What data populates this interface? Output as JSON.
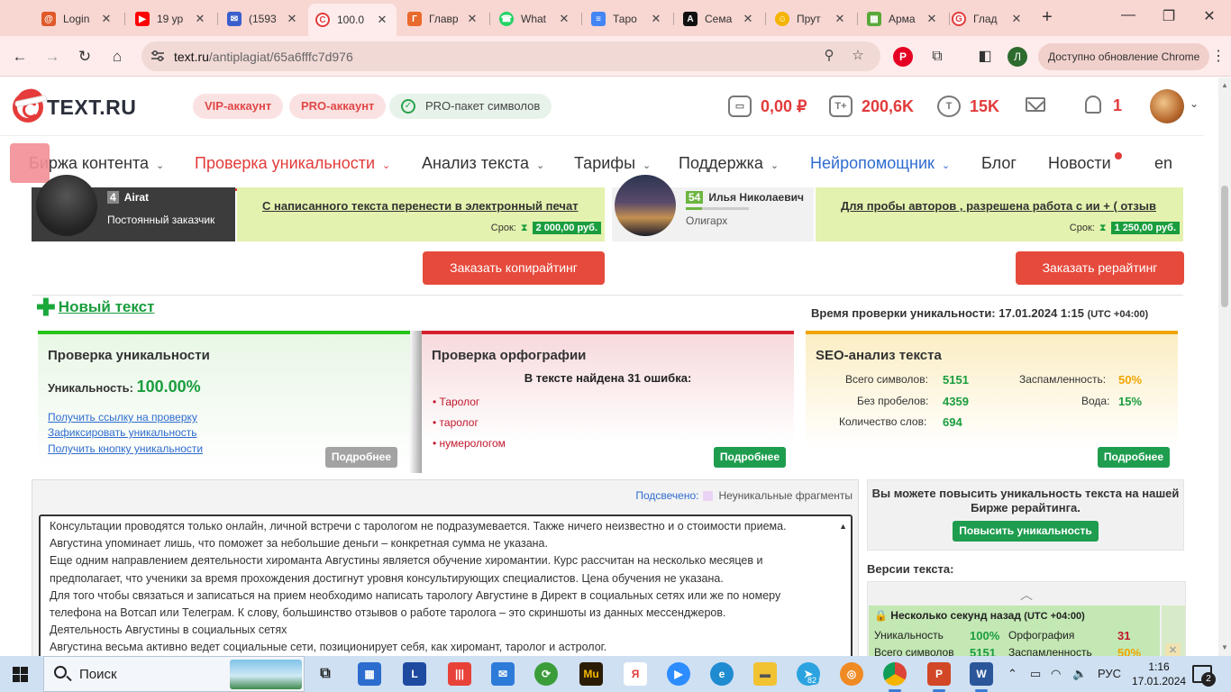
{
  "browser": {
    "tabs": [
      {
        "title": "Login",
        "icon": "mail-icon",
        "color": "#e05a2a"
      },
      {
        "title": "19 ур",
        "icon": "youtube-icon",
        "color": "#ff0000"
      },
      {
        "title": "(1593",
        "icon": "email-icon",
        "color": "#3a5fcd"
      },
      {
        "title": "100.0",
        "icon": "textru-icon",
        "color": "#e23b3b"
      },
      {
        "title": "Главр",
        "icon": "glavred-icon",
        "color": "#e86a2d"
      },
      {
        "title": "What",
        "icon": "whatsapp-icon",
        "color": "#25d366"
      },
      {
        "title": "Таро",
        "icon": "docs-icon",
        "color": "#4285f4"
      },
      {
        "title": "Сема",
        "icon": "advego-icon",
        "color": "#111111"
      },
      {
        "title": "Прут",
        "icon": "prutik-icon",
        "color": "#f4b400"
      },
      {
        "title": "Арма",
        "icon": "arma-icon",
        "color": "#5aa83a"
      },
      {
        "title": "Глад",
        "icon": "gladko-icon",
        "color": "#e23b3b"
      }
    ],
    "url_domain": "text.ru",
    "url_path": "/antiplagiat/65a6fffc7d976",
    "profile_initial": "Л",
    "update_label": "Доступно обновление Chrome"
  },
  "header": {
    "logo": "TEXT.RU",
    "vip": "VIP-аккаунт",
    "pro": "PRO-аккаунт",
    "pkg": "PRO-пакет символов",
    "balance": "0,00 ₽",
    "symbols": "200,6K",
    "tokens": "15K",
    "notifications": "1"
  },
  "nav": {
    "items": [
      "Биржа контента",
      "Проверка уникальности",
      "Анализ текста",
      "Тарифы",
      "Поддержка",
      "Нейропомощник",
      "Блог",
      "Новости",
      "en"
    ]
  },
  "orders": {
    "left_level": "4",
    "left_name": "Airat",
    "left_role": "Постоянный заказчик",
    "left_link": "С написанного текста перенести в электронный печат",
    "term": "Срок:",
    "left_price": "2 000,00 руб.",
    "mid_level": "54",
    "mid_name": "Илья Николаевич",
    "mid_role": "Олигарх",
    "right_link": "Для пробы авторов , разрешена работа с ии + ( отзыв",
    "right_price": "1 250,00 руб."
  },
  "buttons": {
    "order_copy": "Заказать копирайтинг",
    "order_rewrite": "Заказать рерайтинг"
  },
  "newtext": "Новый текст",
  "check_time": {
    "label": "Время проверки уникальности: 17.01.2024 1:15",
    "tz": "(UTC +04:00)"
  },
  "uniq": {
    "title": "Проверка уникальности",
    "label": "Уникальность:",
    "value": "100.00%",
    "links": [
      "Получить ссылку на проверку",
      "Зафиксировать уникальность",
      "Получить кнопку уникальности"
    ],
    "more": "Подробнее"
  },
  "spell": {
    "title": "Проверка орфографии",
    "summary": "В тексте найдена 31 ошибка:",
    "errors": [
      "Таролог",
      "таролог",
      "нумерологом"
    ],
    "more": "Подробнее"
  },
  "seo": {
    "title": "SEO-анализ текста",
    "total_label": "Всего символов:",
    "total": "5151",
    "nospace_label": "Без пробелов:",
    "nospace": "4359",
    "words_label": "Количество слов:",
    "words": "694",
    "spam_label": "Заспамленность:",
    "spam": "50%",
    "water_label": "Вода:",
    "water": "15%",
    "more": "Подробнее"
  },
  "textpanel": {
    "highlighted": "Подсвечено:",
    "legend": "Неуникальные фрагменты",
    "lines": [
      "Консультации проводятся только онлайн, личной встречи с тарологом не подразумевается. Также ничего неизвестно и о стоимости приема.",
      "Августина упоминает лишь, что поможет за небольшие деньги – конкретная сумма не указана.",
      "Еще одним направлением деятельности хироманта Августины является обучение хиромантии. Курс рассчитан на несколько месяцев и",
      "предполагает, что ученики за время прохождения достигнут уровня консультирующих специалистов. Цена обучения не указана.",
      "Для того чтобы связаться и записаться на прием необходимо написать тарологу Августине в Директ в социальных сетях или же по номеру",
      "телефона на Вотсап или Телеграм. К слову, большинство отзывов о работе таролога – это скриншоты из данных мессенджеров.",
      "Деятельность Августины в социальных сетях",
      "Августина весьма активно ведет социальные сети, позиционирует себя, как хиромант, таролог и астролог."
    ]
  },
  "promo": {
    "text": "Вы можете повысить уникальность текста на нашей Бирже рерайтинга.",
    "button": "Повысить уникальность"
  },
  "versions": {
    "title": "Версии текста:",
    "when": "Несколько секунд назад",
    "tz": "(UTC +04:00)",
    "uniq_label": "Уникальность",
    "uniq": "100%",
    "spell_label": "Орфография",
    "spell": "31",
    "total_label": "Всего символов",
    "total": "5151",
    "spam_label": "Заспамленность",
    "spam": "50%"
  },
  "taskbar": {
    "search": "Поиск",
    "lang": "РУС",
    "time": "1:16",
    "date": "17.01.2024",
    "notif_count": "2",
    "telegram_badge": "82"
  }
}
